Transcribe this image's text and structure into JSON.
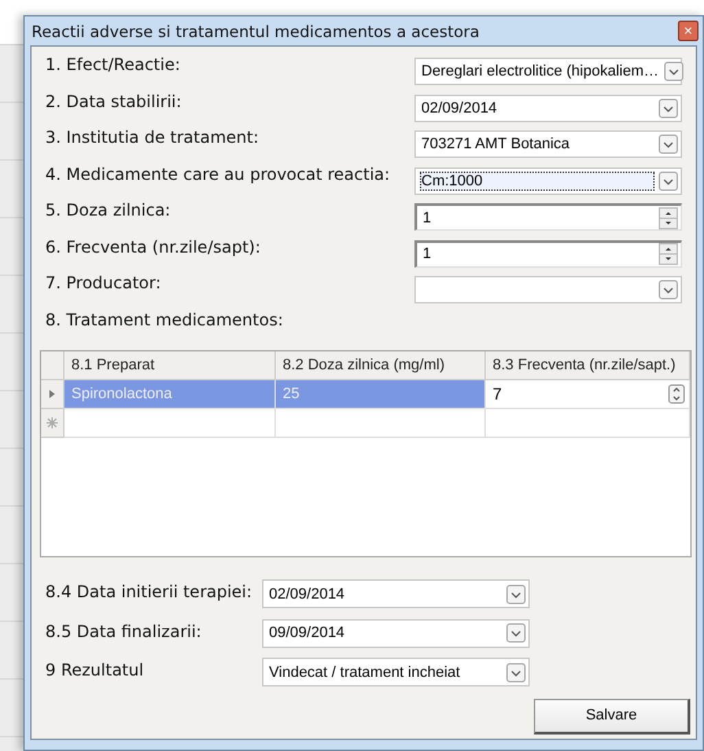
{
  "window": {
    "title": "Reactii adverse si tratamentul medicamentos a acestora",
    "close": "×"
  },
  "fields": [
    {
      "label": "1. Efect/Reactie:",
      "kind": "combo",
      "value": "Dereglari electrolitice (hipokaliem…",
      "focused": false
    },
    {
      "label": "2. Data stabilirii:",
      "kind": "combo",
      "value": "02/09/2014",
      "focused": false
    },
    {
      "label": "3. Institutia de tratament:",
      "kind": "combo",
      "value": "703271 AMT Botanica",
      "focused": false
    },
    {
      "label": "4. Medicamente care au provocat reactia:",
      "kind": "combo",
      "value": "Cm:1000",
      "focused": true
    },
    {
      "label": "5. Doza zilnica:",
      "kind": "spin",
      "value": "1",
      "focused": false
    },
    {
      "label": "6. Frecventa (nr.zile/sapt):",
      "kind": "spin",
      "value": "1",
      "focused": false
    },
    {
      "label": "7. Producator:",
      "kind": "combo",
      "focused": false
    }
  ],
  "section_label": "8. Tratament medicamentos:",
  "table": {
    "columns": [
      "8.1 Preparat",
      "8.2 Doza zilnica (mg/ml)",
      "8.3 Frecventa (nr.zile/sapt.)"
    ],
    "rows": [
      {
        "cells": [
          "Spironolactona",
          "25",
          "7"
        ],
        "selected": true
      }
    ]
  },
  "bottom_fields": [
    {
      "label": "8.4 Data initierii terapiei:",
      "value": "02/09/2014"
    },
    {
      "label": "8.5 Data finalizarii:",
      "value": "09/09/2014"
    },
    {
      "label": "9 Rezultatul",
      "value": "Vindecat / tratament incheiat"
    }
  ],
  "save_button": "Salvare"
}
